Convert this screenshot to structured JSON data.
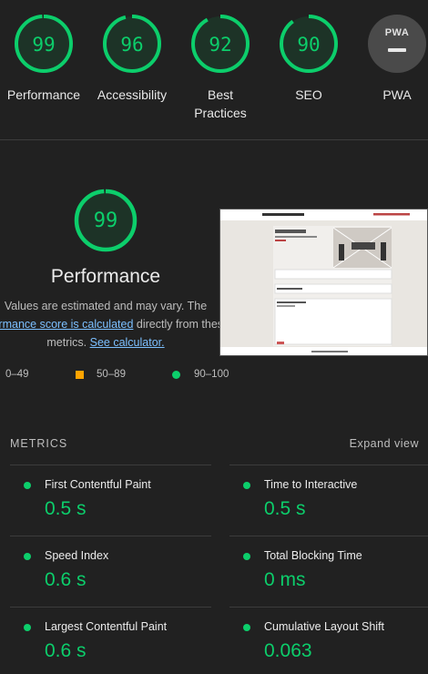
{
  "categories": [
    {
      "label": "Performance",
      "score": "99",
      "value": 99
    },
    {
      "label": "Accessibility",
      "score": "96",
      "value": 96
    },
    {
      "label": "Best Practices",
      "score": "92",
      "value": 92
    },
    {
      "label": "SEO",
      "score": "90",
      "value": 90
    },
    {
      "label": "PWA",
      "badge_text": "PWA"
    }
  ],
  "performance": {
    "score": "99",
    "value": 99,
    "title": "Performance",
    "desc_line1": "Values are estimated and may vary. The",
    "desc_link": "formance score is calculated",
    "desc_line2_rest": " directly from these",
    "desc_line3_start": "metrics. ",
    "desc_calc_link": "See calculator."
  },
  "legend": {
    "poor": "0–49",
    "average": "50–89",
    "good": "90–100"
  },
  "metrics": {
    "title": "METRICS",
    "expand": "Expand view",
    "items": [
      {
        "name": "First Contentful Paint",
        "value": "0.5 s"
      },
      {
        "name": "Time to Interactive",
        "value": "0.5 s"
      },
      {
        "name": "Speed Index",
        "value": "0.6 s"
      },
      {
        "name": "Total Blocking Time",
        "value": "0 ms"
      },
      {
        "name": "Largest Contentful Paint",
        "value": "0.6 s"
      },
      {
        "name": "Cumulative Layout Shift",
        "value": "0.063"
      }
    ]
  },
  "colors": {
    "pass": "#0cce6b",
    "average": "#ffa400",
    "background": "#212121"
  }
}
